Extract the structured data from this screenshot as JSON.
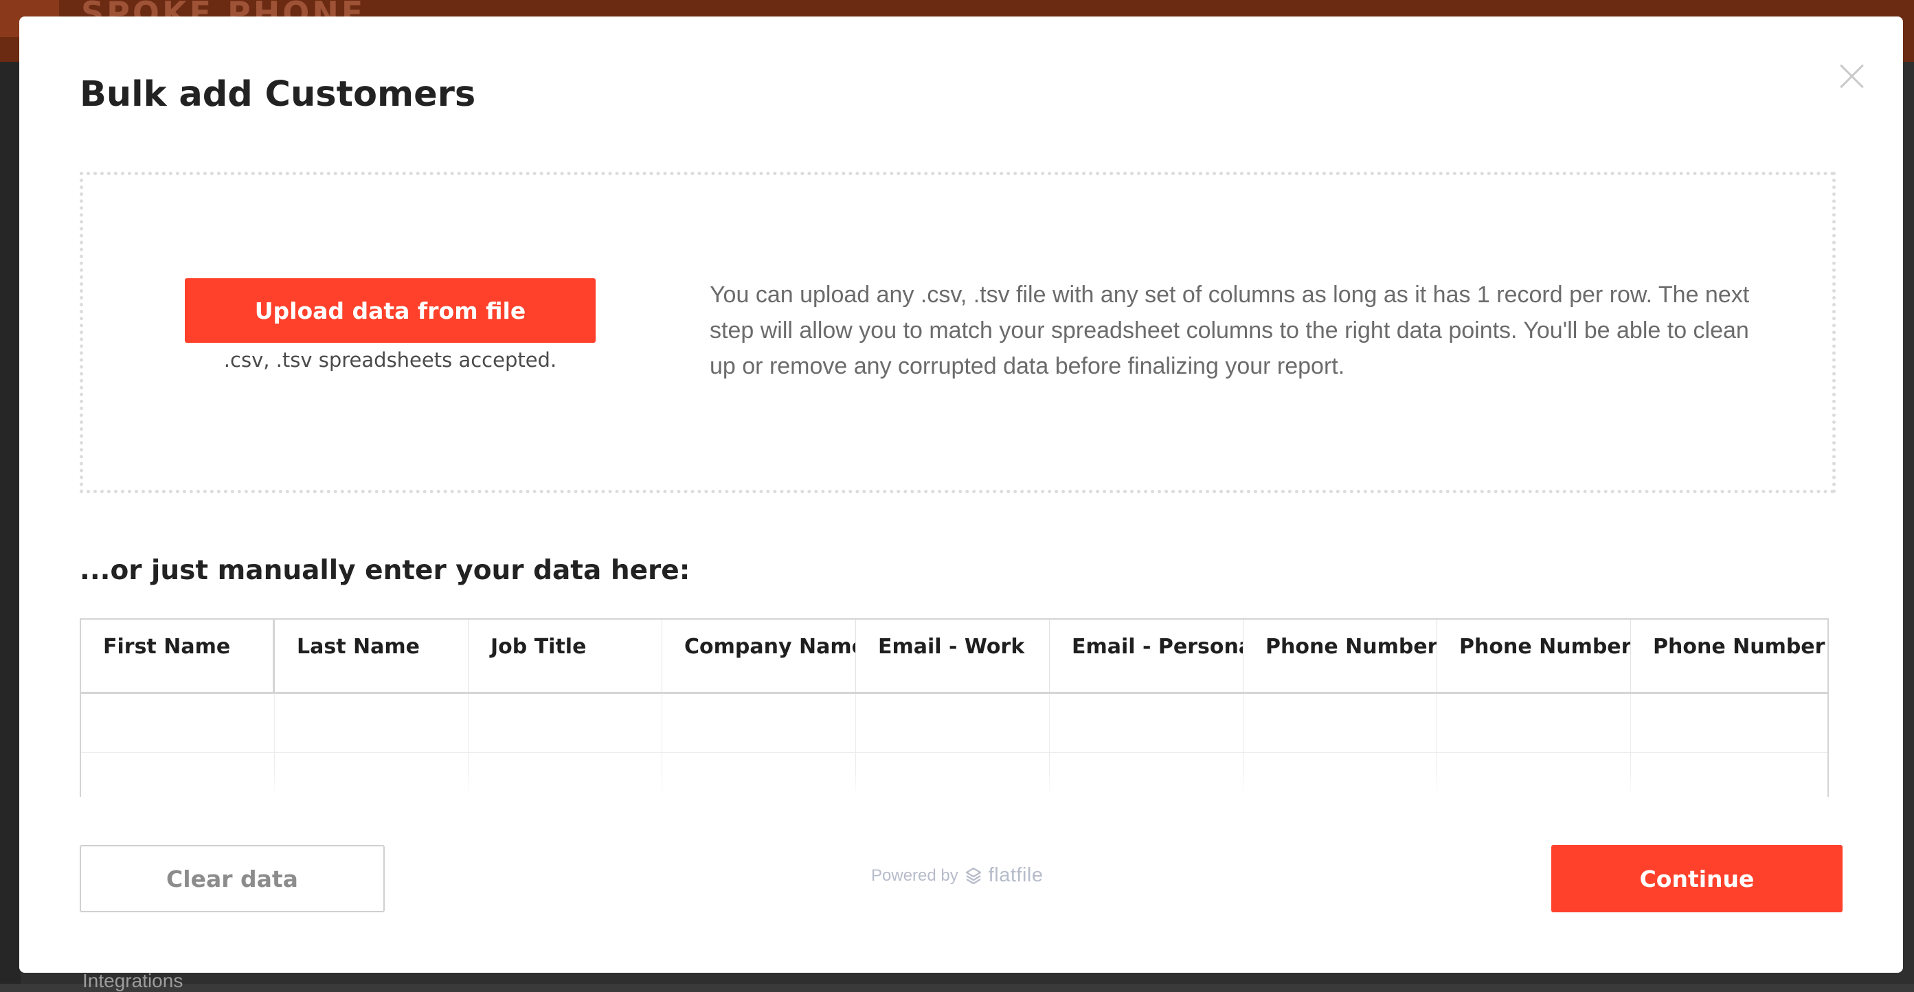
{
  "background": {
    "brand": "SPOKE PHONE",
    "nav_hint": "Integrations"
  },
  "modal": {
    "title": "Bulk add Customers",
    "upload_button": "Upload data from file",
    "upload_hint": ".csv, .tsv spreadsheets accepted.",
    "upload_description": "You can upload any .csv, .tsv file with any set of columns as long as it has 1 record per row. The next step will allow you to match your spreadsheet columns to the right data points. You'll be able to clean up or remove any corrupted data before finalizing your report.",
    "manual_label": "...or just manually enter your data here:",
    "columns": [
      "First Name",
      "Last Name",
      "Job Title",
      "Company Name",
      "Email - Work",
      "Email - Personal",
      "Phone Number - Work",
      "Phone Number - Mobile",
      "Phone Number - Home"
    ],
    "clear_button": "Clear data",
    "powered_by": "Powered by",
    "powered_brand": "flatfile",
    "continue_button": "Continue"
  },
  "colors": {
    "accent": "#ff412b",
    "topbar": "#6b2a12"
  },
  "icons": {
    "close": "close-icon",
    "flatfile": "flatfile-logo-icon"
  }
}
